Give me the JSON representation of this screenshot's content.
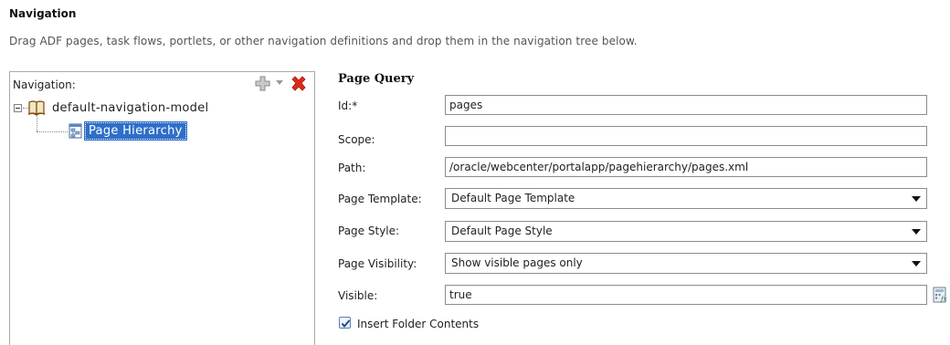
{
  "header": {
    "title": "Navigation",
    "instructions": "Drag ADF pages, task flows, portlets, or other navigation definitions and drop them in the navigation tree below."
  },
  "nav_panel": {
    "label": "Navigation:",
    "toolbar": {
      "add_icon": "add-plus-icon",
      "delete_icon": "delete-x-icon"
    },
    "tree": {
      "root": {
        "label": "default-navigation-model",
        "icon": "book-icon",
        "expanded": true
      },
      "children": [
        {
          "label": "Page Hierarchy",
          "icon": "page-hierarchy-icon",
          "selected": true
        }
      ]
    }
  },
  "form": {
    "title": "Page Query",
    "id": {
      "label": "Id:*",
      "value": "pages"
    },
    "scope": {
      "label": "Scope:",
      "value": ""
    },
    "path": {
      "label": "Path:",
      "value": "/oracle/webcenter/portalapp/pagehierarchy/pages.xml"
    },
    "page_template": {
      "label": "Page Template:",
      "value": "Default Page Template"
    },
    "page_style": {
      "label": "Page Style:",
      "value": "Default Page Style"
    },
    "page_visibility": {
      "label": "Page Visibility:",
      "value": "Show visible pages only"
    },
    "visible": {
      "label": "Visible:",
      "value": "true"
    },
    "insert_folder_contents": {
      "label": "Insert Folder Contents",
      "checked": true
    }
  },
  "colors": {
    "selection": "#2f6ec8",
    "delete": "#e02a1a",
    "border": "#a9a9a9"
  }
}
